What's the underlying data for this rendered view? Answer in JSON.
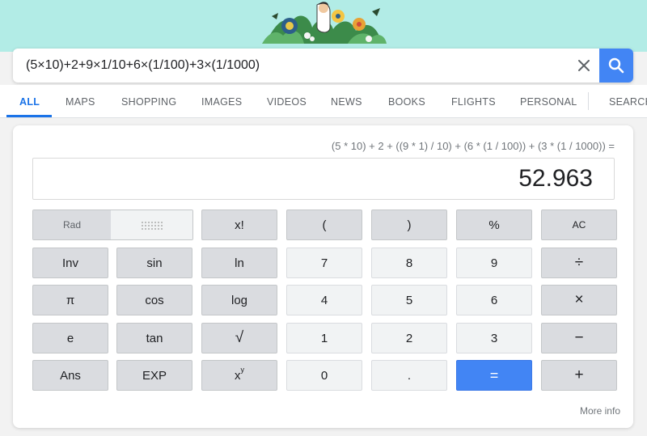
{
  "search": {
    "query": "(5×10)+2+9×1/10+6×(1/100)+3×(1/1000)",
    "clear_icon": "close-icon",
    "submit_icon": "search-icon"
  },
  "tabs": [
    {
      "label": "ALL",
      "active": true
    },
    {
      "label": "MAPS"
    },
    {
      "label": "SHOPPING"
    },
    {
      "label": "IMAGES"
    },
    {
      "label": "VIDEOS"
    },
    {
      "label": "NEWS"
    },
    {
      "label": "BOOKS"
    },
    {
      "label": "FLIGHTS"
    },
    {
      "label": "PERSONAL"
    },
    {
      "label": "SEARCH"
    }
  ],
  "calculator": {
    "expression": "(5 * 10) + 2 + ((9 * 1) / 10) + (6 * (1 / 100)) + (3 * (1 / 1000)) =",
    "result": "52.963",
    "angle_mode": {
      "rad_label": "Rad",
      "deg_label": "Deg",
      "selected": "Rad"
    },
    "keys": {
      "fact": "x!",
      "lparen": "(",
      "rparen": ")",
      "percent": "%",
      "clear": "AC",
      "inv": "Inv",
      "sin": "sin",
      "ln": "ln",
      "seven": "7",
      "eight": "8",
      "nine": "9",
      "divide": "÷",
      "pi": "π",
      "cos": "cos",
      "log": "log",
      "four": "4",
      "five": "5",
      "six": "6",
      "multiply": "×",
      "e": "e",
      "tan": "tan",
      "sqrt": "√",
      "one": "1",
      "two": "2",
      "three": "3",
      "minus": "−",
      "ans": "Ans",
      "exp": "EXP",
      "pow_base": "x",
      "pow_exp": "y",
      "zero": "0",
      "point": ".",
      "equals": "=",
      "plus": "+"
    },
    "more_info": "More info"
  },
  "colors": {
    "accent": "#4285f4",
    "active_tab": "#1a73e8",
    "doodle_bg": "#b2ece6"
  }
}
